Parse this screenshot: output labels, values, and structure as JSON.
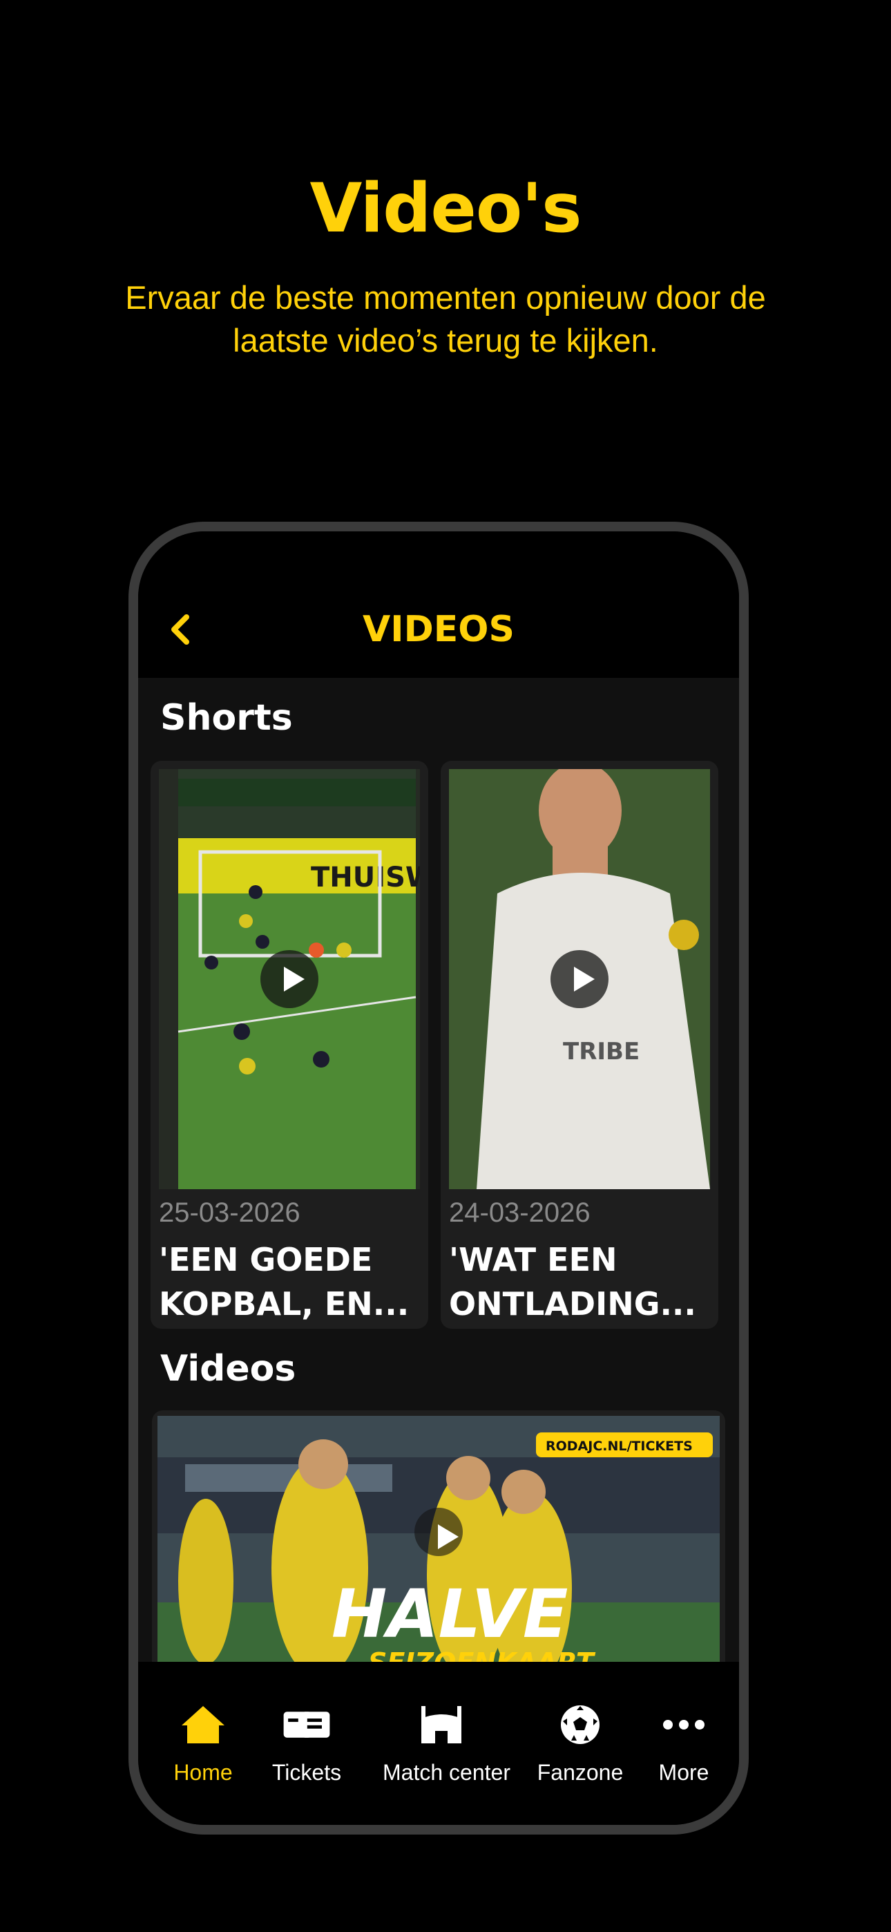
{
  "promo": {
    "title": "Video's",
    "subtitle": "Ervaar de beste momenten opnieuw door de laatste video’s terug te kijken."
  },
  "header": {
    "title": "VIDEOS",
    "back_icon": "chevron-left-icon"
  },
  "shorts": {
    "heading": "Shorts",
    "items": [
      {
        "date": "25-03-2026",
        "title": "'EEN GOEDE\nKOPBAL, EN..."
      },
      {
        "date": "24-03-2026",
        "title": "'WAT EEN\nONTLADING..."
      }
    ]
  },
  "videos": {
    "heading": "Videos",
    "featured": {
      "banner": "RODAJC.NL/TICKETS",
      "headline": "HALVE",
      "subheadline": "SEIZOENKAART"
    }
  },
  "tabbar": {
    "items": [
      {
        "label": "Home",
        "icon": "home-icon",
        "active": true
      },
      {
        "label": "Tickets",
        "icon": "ticket-icon"
      },
      {
        "label": "Match center",
        "icon": "stadium-icon"
      },
      {
        "label": "Fanzone",
        "icon": "football-icon"
      },
      {
        "label": "More",
        "icon": "more-dots-icon"
      }
    ]
  },
  "colors": {
    "accent": "#FFD10A",
    "background": "#000000",
    "surface": "#111111",
    "card": "#1E1E1E"
  }
}
